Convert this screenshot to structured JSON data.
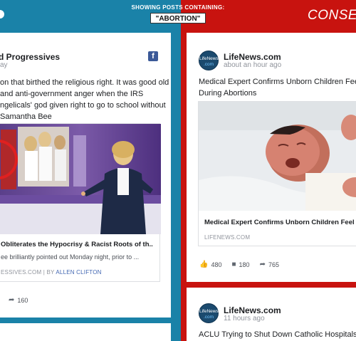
{
  "header": {
    "showing_label": "SHOWING POSTS CONTAINING:",
    "search_term": "\"ABORTION\"",
    "right_column_title": "CONSER"
  },
  "colors": {
    "liberal_blue": "#1a82a8",
    "conservative_red": "#c8130f",
    "facebook_blue": "#3b5998",
    "link_blue": "#4267b2"
  },
  "left_post": {
    "source": "d Progressives",
    "time": "ay",
    "source_icon": "facebook-icon",
    "text_lines": [
      "on that birthed the religious right. It was good old",
      "and anti-government anger when the IRS",
      "ngelicals' god given right to go to school without",
      "Samantha Bee"
    ],
    "link_title": "Obliterates the Hypocrisy & Racist Roots of th..",
    "link_desc": "ee brilliantly pointed out Monday night, prior to ...",
    "link_domain": "ESSIVES.COM",
    "link_by": "| BY",
    "link_author": "ALLEN CLIFTON",
    "shares": "160"
  },
  "right_post_1": {
    "avatar_text": "LifeNews",
    "avatar_suffix": ".com",
    "source": "LifeNews.com",
    "time": "about an hour ago",
    "text_lines": [
      "Medical Expert Confirms Unborn Children Feel E",
      "During Abortions"
    ],
    "link_title": "Medical Expert Confirms Unborn Children Feel I",
    "link_domain": "LIFENEWS.COM",
    "likes": "480",
    "comments": "180",
    "shares": "765"
  },
  "right_post_2": {
    "avatar_text": "LifeNews",
    "avatar_suffix": ".com",
    "source": "LifeNews.com",
    "time": "11 hours ago",
    "text": "ACLU Trying to Shut Down Catholic Hospitals Be"
  }
}
